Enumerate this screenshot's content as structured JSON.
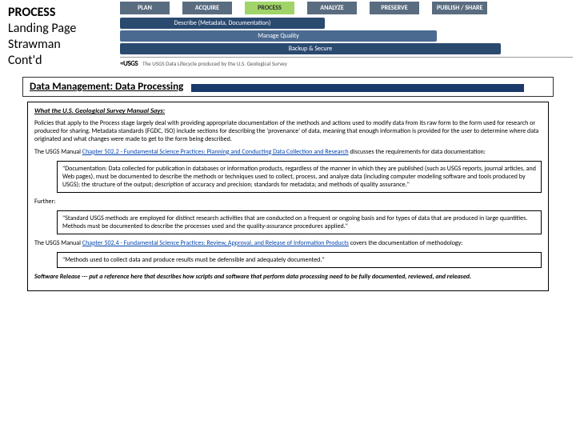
{
  "title": {
    "line1": "PROCESS",
    "line2": "Landing Page",
    "line3": "Strawman",
    "line4": "Cont'd"
  },
  "lifecycle": {
    "stages": [
      "PLAN",
      "ACQUIRE",
      "PROCESS",
      "ANALYZE",
      "PRESERVE",
      "PUBLISH / SHARE"
    ],
    "active_index": 2,
    "bars": [
      "Describe (Metadata, Documentation)",
      "Manage Quality",
      "Backup & Secure"
    ],
    "usgs_logo": "≈USGS",
    "usgs_tagline": "The USGS Data Lifecycle produced by the U.S. Geological Survey"
  },
  "heading": "Data Management: Data Processing",
  "body": {
    "section_head": "What the U.S. Geological Survey Manual Says:",
    "p1": "Policies that apply to the Process stage largely deal with providing appropriate documentation of the methods and actions used to modify data from its raw form to the form used for research or produced for sharing. Metadata standards (FGDC, ISO) include sections for describing the 'provenance' of data, meaning that enough information is provided for the user to determine where data originated and what changes were made to get to the form being described.",
    "p2a": "The USGS Manual ",
    "p2link": "Chapter 502.2 - Fundamental Science Practices: Planning and Conducting Data Collection and Research",
    "p2b": " discusses the requirements for data documentation:",
    "q1": "\"Documentation: Data collected for publication in databases or information products, regardless of the manner in which they are published (such as USGS reports, journal articles, and Web pages), must be documented to describe the methods or techniques used to collect, process, and analyze data (including computer modeling software and tools produced by USGS); the structure of the output; description of accuracy and precision; standards for metadata; and methods of quality assurance.\"",
    "further": "Further:",
    "q2": "\"Standard USGS methods are employed for distinct research activities that are conducted on a frequent or ongoing basis and for types of data that are produced in large quantities. Methods must be documented to describe the processes used and the quality-assurance procedures applied.\"",
    "p3a": "The USGS Manual ",
    "p3link": "Chapter 502.4 - Fundamental Science Practices: Review, Approval, and Release of Information Products",
    "p3b": " covers the documentation of methodology:",
    "q3": "\"Methods used to collect data and produce results must be defensible and adequately documented.\"",
    "p4": "Software Release --- put a reference here that describes how scripts and software that perform data processing need to be fully documented, reviewed, and released."
  }
}
